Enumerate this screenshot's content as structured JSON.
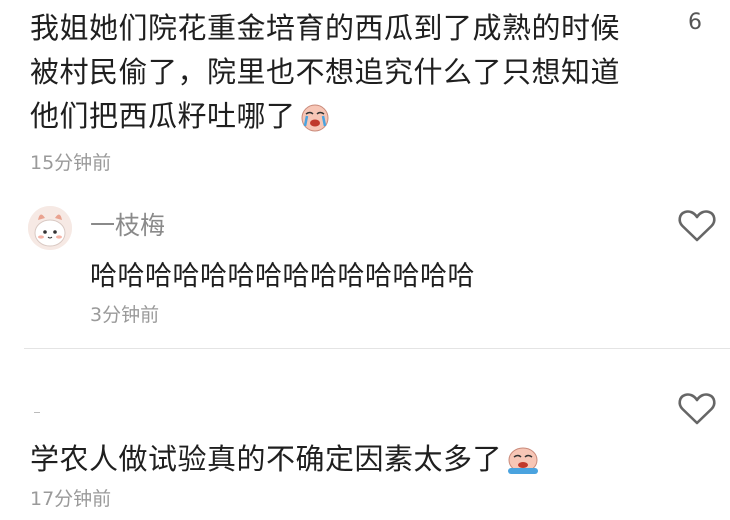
{
  "comments": [
    {
      "text": "我姐她们院花重金培育的西瓜到了成熟的时候被村民偷了，院里也不想追究什么了只想知道他们把西瓜籽吐哪了",
      "time": "15分钟前",
      "like_count": "6",
      "emoji": "crying-face-emoji"
    },
    {
      "username": "一枝梅",
      "text": "哈哈哈哈哈哈哈哈哈哈哈哈哈哈",
      "time": "3分钟前",
      "avatar": "cartoon-bunny-avatar",
      "icon": "heart-outline-icon"
    },
    {
      "text": "学农人做试验真的不确定因素太多了",
      "time": "17分钟前",
      "emoji": "crying-face-emoji",
      "icon": "heart-outline-icon"
    }
  ],
  "colors": {
    "text": "#1f1f1f",
    "muted": "#9a9a9a",
    "divider": "#e4e4e4",
    "heart": "#666666"
  }
}
